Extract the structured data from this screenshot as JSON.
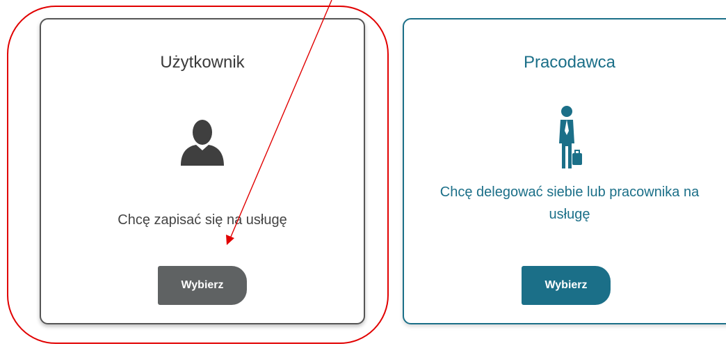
{
  "cards": [
    {
      "title": "Użytkownik",
      "description": "Chcę zapisać się na usługę",
      "button_label": "Wybierz",
      "icon": "user-silhouette-icon"
    },
    {
      "title": "Pracodawca",
      "description": "Chcę delegować siebie lub pracownika na usługę",
      "button_label": "Wybierz",
      "icon": "businessman-briefcase-icon"
    }
  ],
  "annotation": {
    "outline_color": "#e10000",
    "arrow_color": "#e10000"
  },
  "colors": {
    "user_button": "#5f6263",
    "employer_accent": "#1b6f88"
  }
}
